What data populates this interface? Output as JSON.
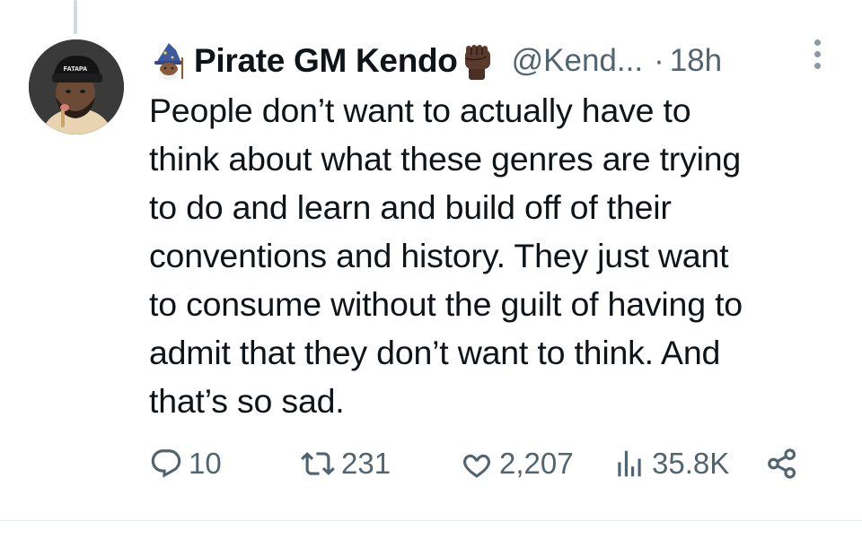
{
  "tweet": {
    "display_name": "Pirate GM Kendo",
    "handle": "@Kend...",
    "separator": "·",
    "time": "18h",
    "avatar_hat_text": "FATAPA",
    "text": "People don’t want to actually have to\nthink about what these genres are trying\nto do and learn and build off of their\nconventions and history. They just want\nto consume without the guilt of having to\nadmit that they don’t want to think. And\nthat’s so sad.",
    "stats": {
      "replies": "10",
      "retweets": "231",
      "likes": "2,207",
      "views": "35.8K"
    }
  },
  "icons": {
    "name_prefix": "wizard-emoji",
    "name_suffix": "raised-fist-emoji",
    "more": "more-vertical-icon",
    "reply": "reply-icon",
    "retweet": "retweet-icon",
    "like": "heart-icon",
    "views": "views-chart-icon",
    "share": "share-icon"
  },
  "colors": {
    "text": "#0f1419",
    "secondary": "#536471",
    "divider": "#e6ecf0"
  }
}
